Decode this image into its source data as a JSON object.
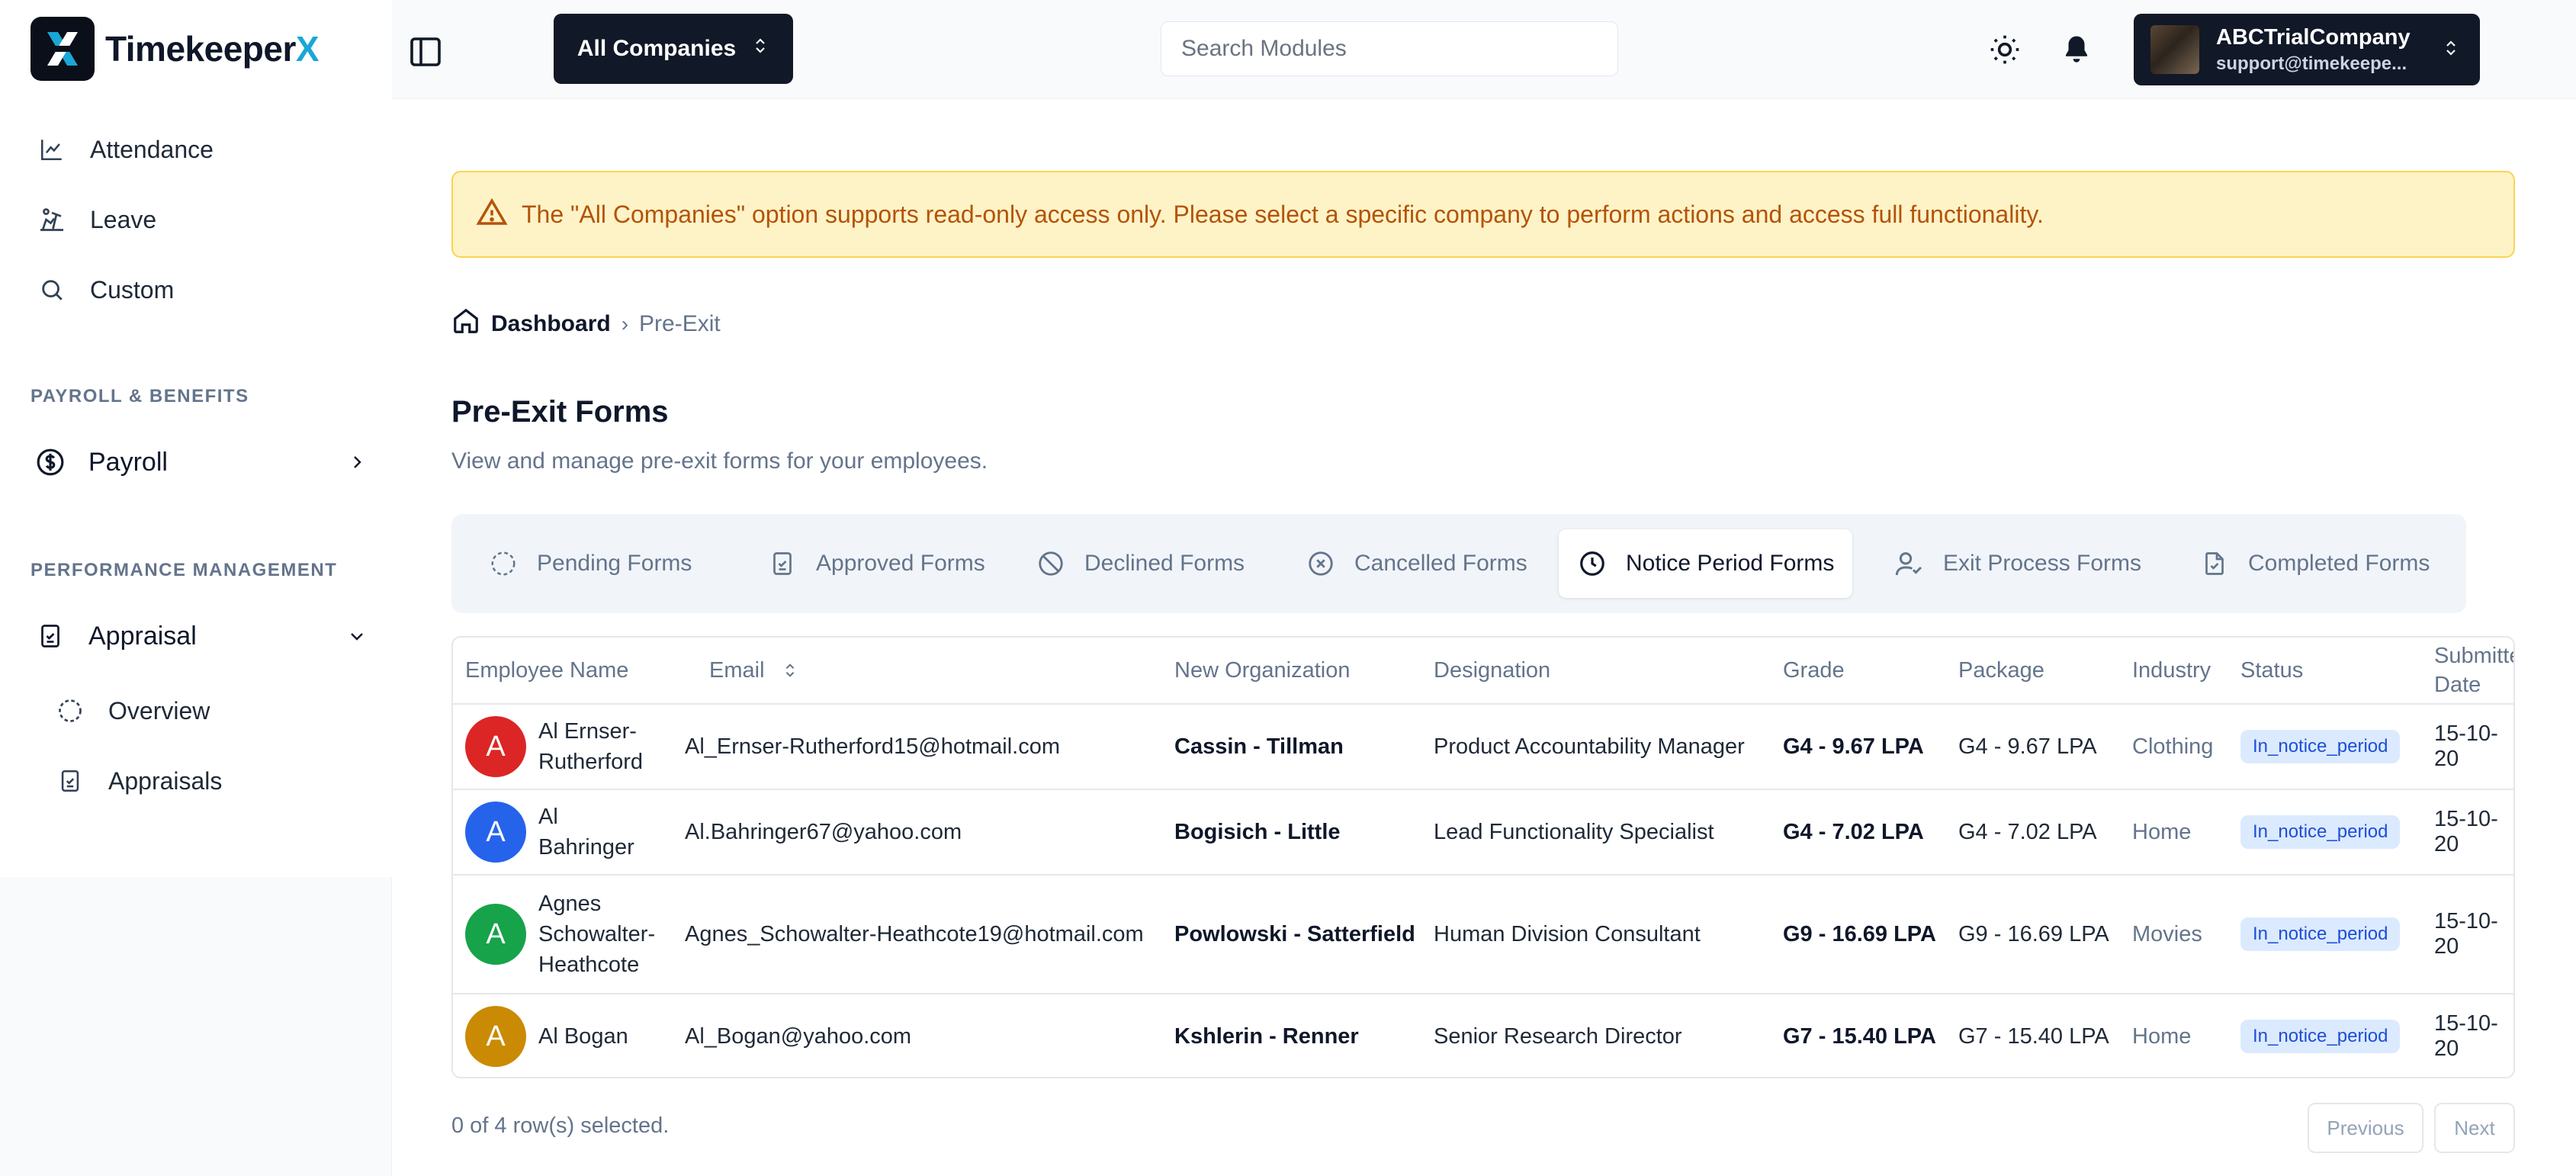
{
  "app": {
    "name_main": "Timekeeper",
    "name_accent": "X"
  },
  "sidebar": {
    "items": [
      {
        "label": "Attendance",
        "icon": "chart-line-icon"
      },
      {
        "label": "Leave",
        "icon": "beach-icon"
      },
      {
        "label": "Custom",
        "icon": "search-icon"
      }
    ],
    "section_payroll": "PAYROLL & BENEFITS",
    "payroll": {
      "label": "Payroll",
      "icon": "dollar-circle-icon"
    },
    "section_performance": "PERFORMANCE MANAGEMENT",
    "appraisal": {
      "label": "Appraisal",
      "icon": "clipboard-check-icon"
    },
    "appraisal_sub": [
      {
        "label": "Overview",
        "icon": "dashed-circle-icon"
      },
      {
        "label": "Appraisals",
        "icon": "clipboard-check-icon"
      }
    ]
  },
  "header": {
    "company_select": "All Companies",
    "search_placeholder": "Search Modules",
    "user_name": "ABCTrialCompany",
    "user_email": "support@timekeepe..."
  },
  "alert": {
    "text": "The \"All Companies\" option supports read-only access only. Please select a specific company to perform actions and access full functionality."
  },
  "breadcrumb": {
    "home": "Dashboard",
    "sep": "›",
    "current": "Pre-Exit"
  },
  "page": {
    "title": "Pre-Exit Forms",
    "subtitle": "View and manage pre-exit forms for your employees."
  },
  "tabs": [
    {
      "label": "Pending Forms",
      "icon": "dashed-circle-icon"
    },
    {
      "label": "Approved Forms",
      "icon": "clipboard-check-icon"
    },
    {
      "label": "Declined Forms",
      "icon": "ban-icon"
    },
    {
      "label": "Cancelled Forms",
      "icon": "x-circle-icon"
    },
    {
      "label": "Notice Period Forms",
      "icon": "clock-icon",
      "active": true
    },
    {
      "label": "Exit Process Forms",
      "icon": "user-check-icon"
    },
    {
      "label": "Completed Forms",
      "icon": "file-check-icon"
    }
  ],
  "table": {
    "headers": [
      "Employee Name",
      "Email",
      "New Organization",
      "Designation",
      "Grade",
      "Package",
      "Industry",
      "Status",
      "Submitte",
      "Date"
    ],
    "rows": [
      {
        "initial": "A",
        "avatar_color": "#dc2626",
        "name_lines": [
          "Al Ernser-",
          "Rutherford"
        ],
        "email": "Al_Ernser-Rutherford15@hotmail.com",
        "org": "Cassin - Tillman",
        "designation": "Product Accountability Manager",
        "grade": "G4 - 9.67 LPA",
        "package": "G4 - 9.67 LPA",
        "industry": "Clothing",
        "status": "In_notice_period",
        "date": "15-10-20"
      },
      {
        "initial": "A",
        "avatar_color": "#2563eb",
        "name_lines": [
          "Al",
          "Bahringer"
        ],
        "email": "Al.Bahringer67@yahoo.com",
        "org": "Bogisich - Little",
        "designation": "Lead Functionality Specialist",
        "grade": "G4 - 7.02 LPA",
        "package": "G4 - 7.02 LPA",
        "industry": "Home",
        "status": "In_notice_period",
        "date": "15-10-20"
      },
      {
        "initial": "A",
        "avatar_color": "#16a34a",
        "name_lines": [
          "Agnes",
          "Schowalter-",
          "Heathcote"
        ],
        "email": "Agnes_Schowalter-Heathcote19@hotmail.com",
        "org": "Powlowski - Satterfield",
        "designation": "Human Division Consultant",
        "grade": "G9 - 16.69 LPA",
        "package": "G9 - 16.69 LPA",
        "industry": "Movies",
        "status": "In_notice_period",
        "date": "15-10-20"
      },
      {
        "initial": "A",
        "avatar_color": "#ca8a04",
        "name_lines": [
          "Al Bogan"
        ],
        "email": "Al_Bogan@yahoo.com",
        "org": "Kshlerin - Renner",
        "designation": "Senior Research Director",
        "grade": "G7 - 15.40 LPA",
        "package": "G7 - 15.40 LPA",
        "industry": "Home",
        "status": "In_notice_period",
        "date": "15-10-20"
      }
    ]
  },
  "footer": {
    "selection": "0 of 4 row(s) selected.",
    "previous": "Previous",
    "next": "Next"
  }
}
